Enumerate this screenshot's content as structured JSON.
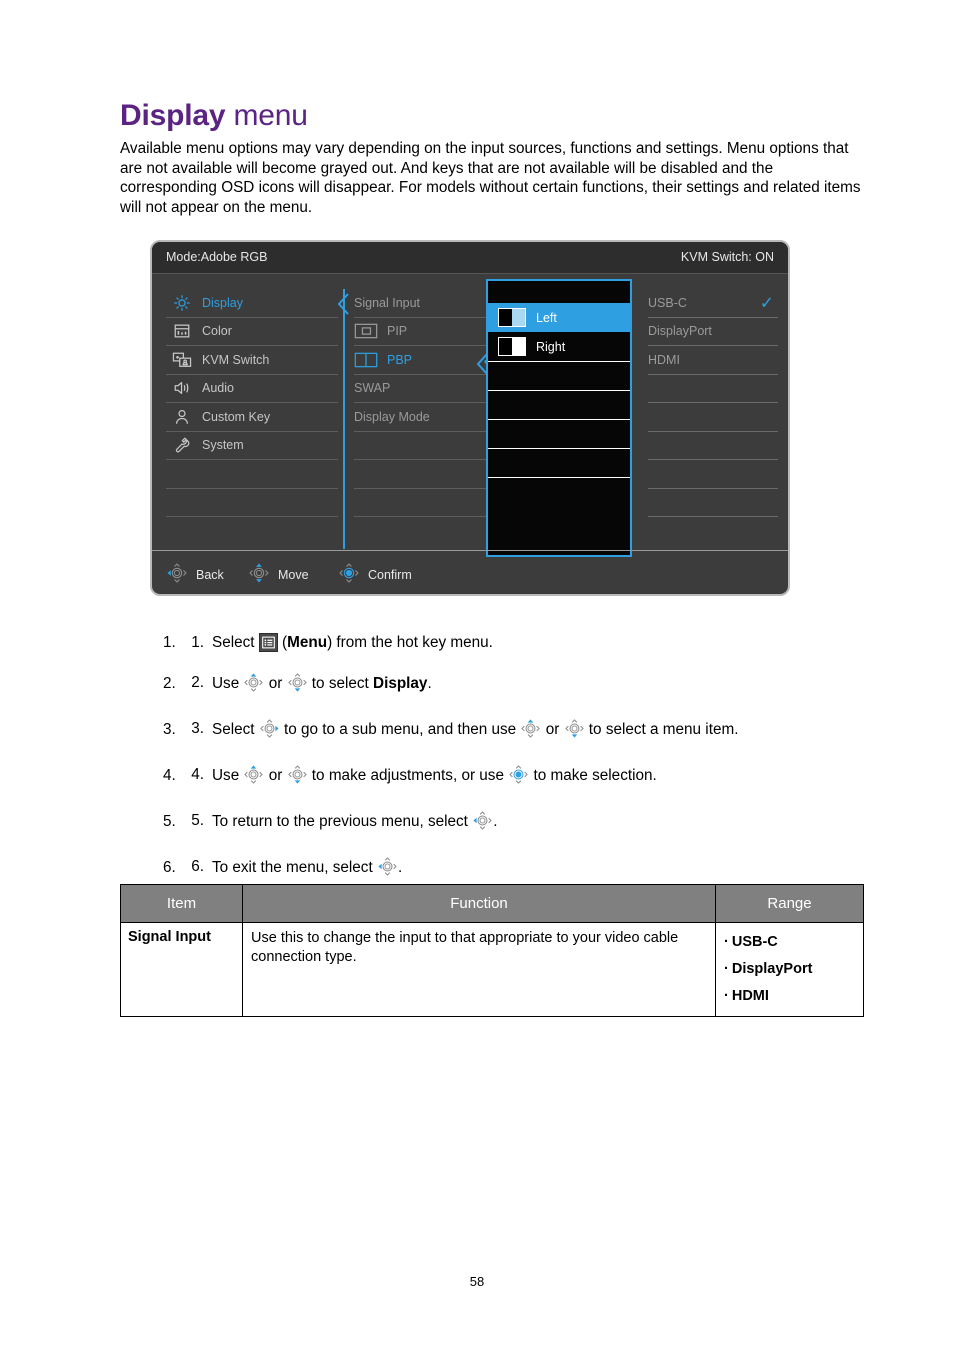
{
  "title": {
    "bold": "Display",
    "light": "menu"
  },
  "intro": "Available menu options may vary depending on the input sources, functions and settings. Menu options that are not available will become grayed out. And keys that are not available will be disabled and the corresponding OSD icons will disappear. For models without certain functions, their settings and related items will not appear on the menu.",
  "colors": {
    "title_purple": "#5b2483",
    "osd_accent_blue": "#2e9fe0",
    "osd_background": "#3c3c3c",
    "osd_header_background": "#2d2d2d",
    "popup_background": "#060606",
    "table_header_gray": "#808080"
  },
  "osd": {
    "header": {
      "mode": "Mode:Adobe RGB",
      "kvm": "KVM Switch: ON"
    },
    "sidebar": [
      {
        "label": "Display",
        "icon": "brightness-icon",
        "active": true
      },
      {
        "label": "Color",
        "icon": "color-panel-icon",
        "active": false
      },
      {
        "label": "KVM Switch",
        "icon": "kvm-switch-icon",
        "active": false
      },
      {
        "label": "Audio",
        "icon": "speaker-icon",
        "active": false
      },
      {
        "label": "Custom Key",
        "icon": "user-icon",
        "active": false
      },
      {
        "label": "System",
        "icon": "wrench-icon",
        "active": false
      }
    ],
    "submenu": [
      {
        "label": "Signal Input",
        "icon": null,
        "highlight": false,
        "checked": false
      },
      {
        "label": "PIP",
        "icon": "pip-icon",
        "highlight": false,
        "checked": false
      },
      {
        "label": "PBP",
        "icon": "pbp-icon",
        "highlight": true,
        "checked": true
      },
      {
        "label": "SWAP",
        "icon": null,
        "highlight": false,
        "checked": false
      },
      {
        "label": "Display Mode",
        "icon": null,
        "highlight": false,
        "checked": false
      }
    ],
    "popup": [
      {
        "label": "Left",
        "icon": "split-left-icon",
        "selected": true
      },
      {
        "label": "Right",
        "icon": "split-right-icon",
        "selected": false
      }
    ],
    "sources": [
      {
        "label": "USB-C",
        "checked": true
      },
      {
        "label": "DisplayPort",
        "checked": false
      },
      {
        "label": "HDMI",
        "checked": false
      }
    ],
    "footer": [
      {
        "label": "Back",
        "key": "left-nav-key-icon"
      },
      {
        "label": "Move",
        "key": "updown-nav-key-icon"
      },
      {
        "label": "Confirm",
        "key": "center-nav-key-icon"
      }
    ]
  },
  "steps": [
    {
      "num": "1.",
      "parts": [
        {
          "t": "text",
          "v": "Select "
        },
        {
          "t": "menuicon"
        },
        {
          "t": "text",
          "v": " ("
        },
        {
          "t": "bold",
          "v": "Menu"
        },
        {
          "t": "text",
          "v": ") from the hot key menu."
        }
      ]
    },
    {
      "num": "2.",
      "parts": [
        {
          "t": "text",
          "v": "Use "
        },
        {
          "t": "key",
          "v": "up"
        },
        {
          "t": "text",
          "v": " or "
        },
        {
          "t": "key",
          "v": "down"
        },
        {
          "t": "text",
          "v": " to select "
        },
        {
          "t": "bold",
          "v": "Display"
        },
        {
          "t": "text",
          "v": "."
        }
      ]
    },
    {
      "num": "3.",
      "parts": [
        {
          "t": "text",
          "v": "Select "
        },
        {
          "t": "key",
          "v": "right"
        },
        {
          "t": "text",
          "v": " to go to a sub menu, and then use "
        },
        {
          "t": "key",
          "v": "up"
        },
        {
          "t": "text",
          "v": " or "
        },
        {
          "t": "key",
          "v": "down"
        },
        {
          "t": "text",
          "v": " to select a menu item."
        }
      ]
    },
    {
      "num": "4.",
      "parts": [
        {
          "t": "text",
          "v": "Use "
        },
        {
          "t": "key",
          "v": "up"
        },
        {
          "t": "text",
          "v": " or "
        },
        {
          "t": "key",
          "v": "down"
        },
        {
          "t": "text",
          "v": " to make adjustments, or use "
        },
        {
          "t": "key",
          "v": "center"
        },
        {
          "t": "text",
          "v": " to make selection."
        }
      ]
    },
    {
      "num": "5.",
      "parts": [
        {
          "t": "text",
          "v": "To return to the previous menu, select "
        },
        {
          "t": "key",
          "v": "left"
        },
        {
          "t": "text",
          "v": "."
        }
      ]
    },
    {
      "num": "6.",
      "parts": [
        {
          "t": "text",
          "v": "To exit the menu, select "
        },
        {
          "t": "key",
          "v": "left"
        },
        {
          "t": "text",
          "v": "."
        }
      ]
    }
  ],
  "table": {
    "headers": [
      "Item",
      "Function",
      "Range"
    ],
    "rows": [
      {
        "item": "Signal Input",
        "function": "Use this to change the input to that appropriate to your video cable connection type.",
        "range": [
          "USB-C",
          "DisplayPort",
          "HDMI"
        ]
      }
    ]
  },
  "page_number": "58"
}
